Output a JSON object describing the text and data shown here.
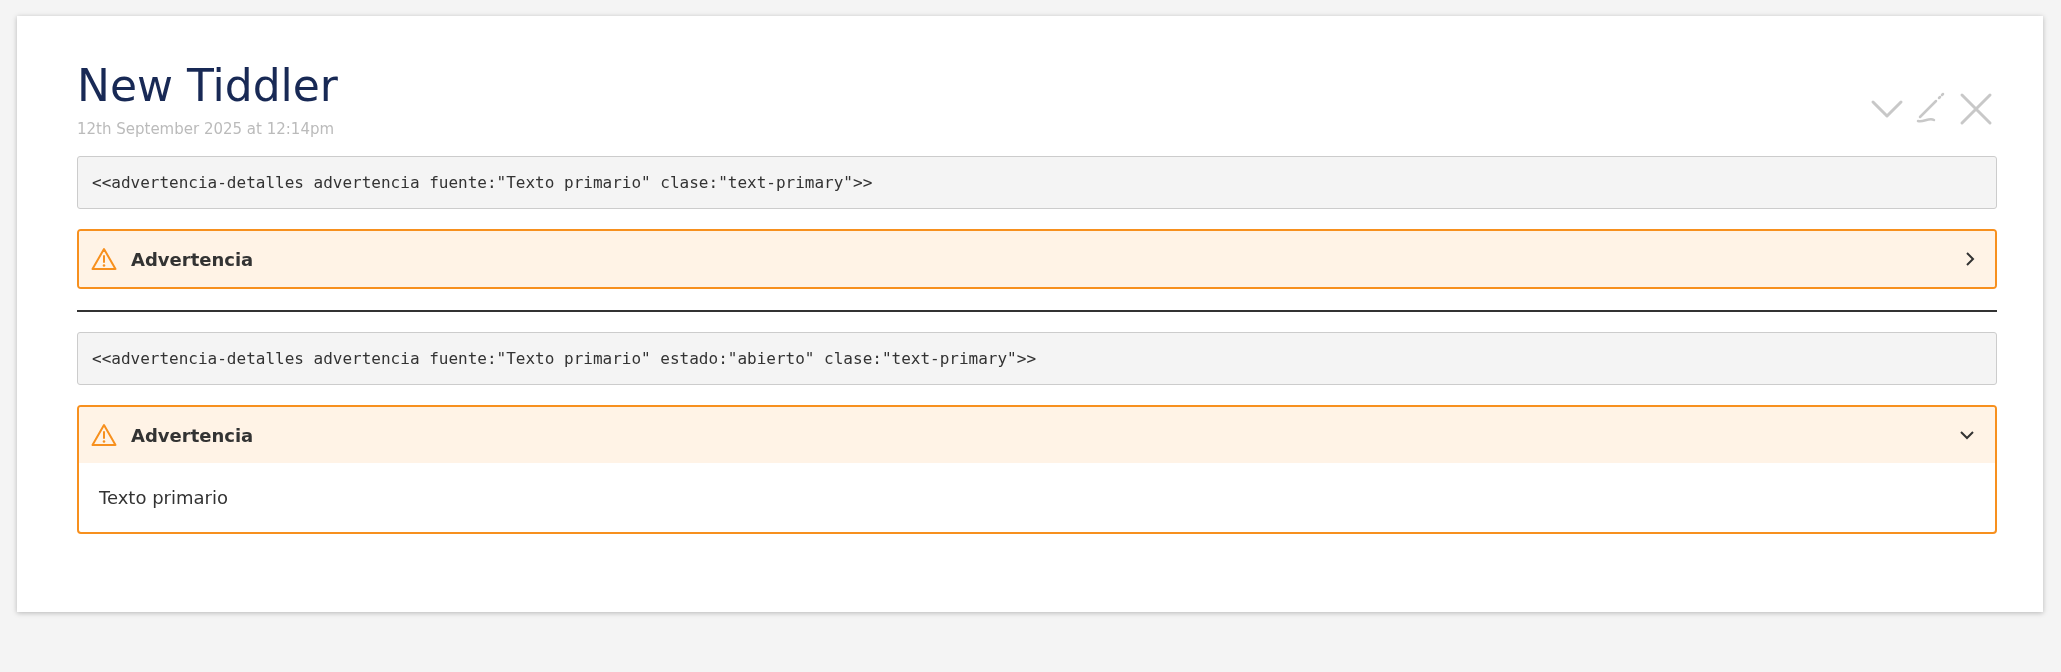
{
  "tiddler": {
    "title": "New Tiddler",
    "date": "12th September 2025 at 12:14pm"
  },
  "examples": [
    {
      "code": "<<advertencia-detalles advertencia fuente:\"Texto primario\" clase:\"text-primary\">>",
      "alert": {
        "title": "Advertencia",
        "expanded": false
      }
    },
    {
      "code": "<<advertencia-detalles advertencia fuente:\"Texto primario\" estado:\"abierto\" clase:\"text-primary\">>",
      "alert": {
        "title": "Advertencia",
        "expanded": true,
        "body": "Texto primario"
      }
    }
  ]
}
